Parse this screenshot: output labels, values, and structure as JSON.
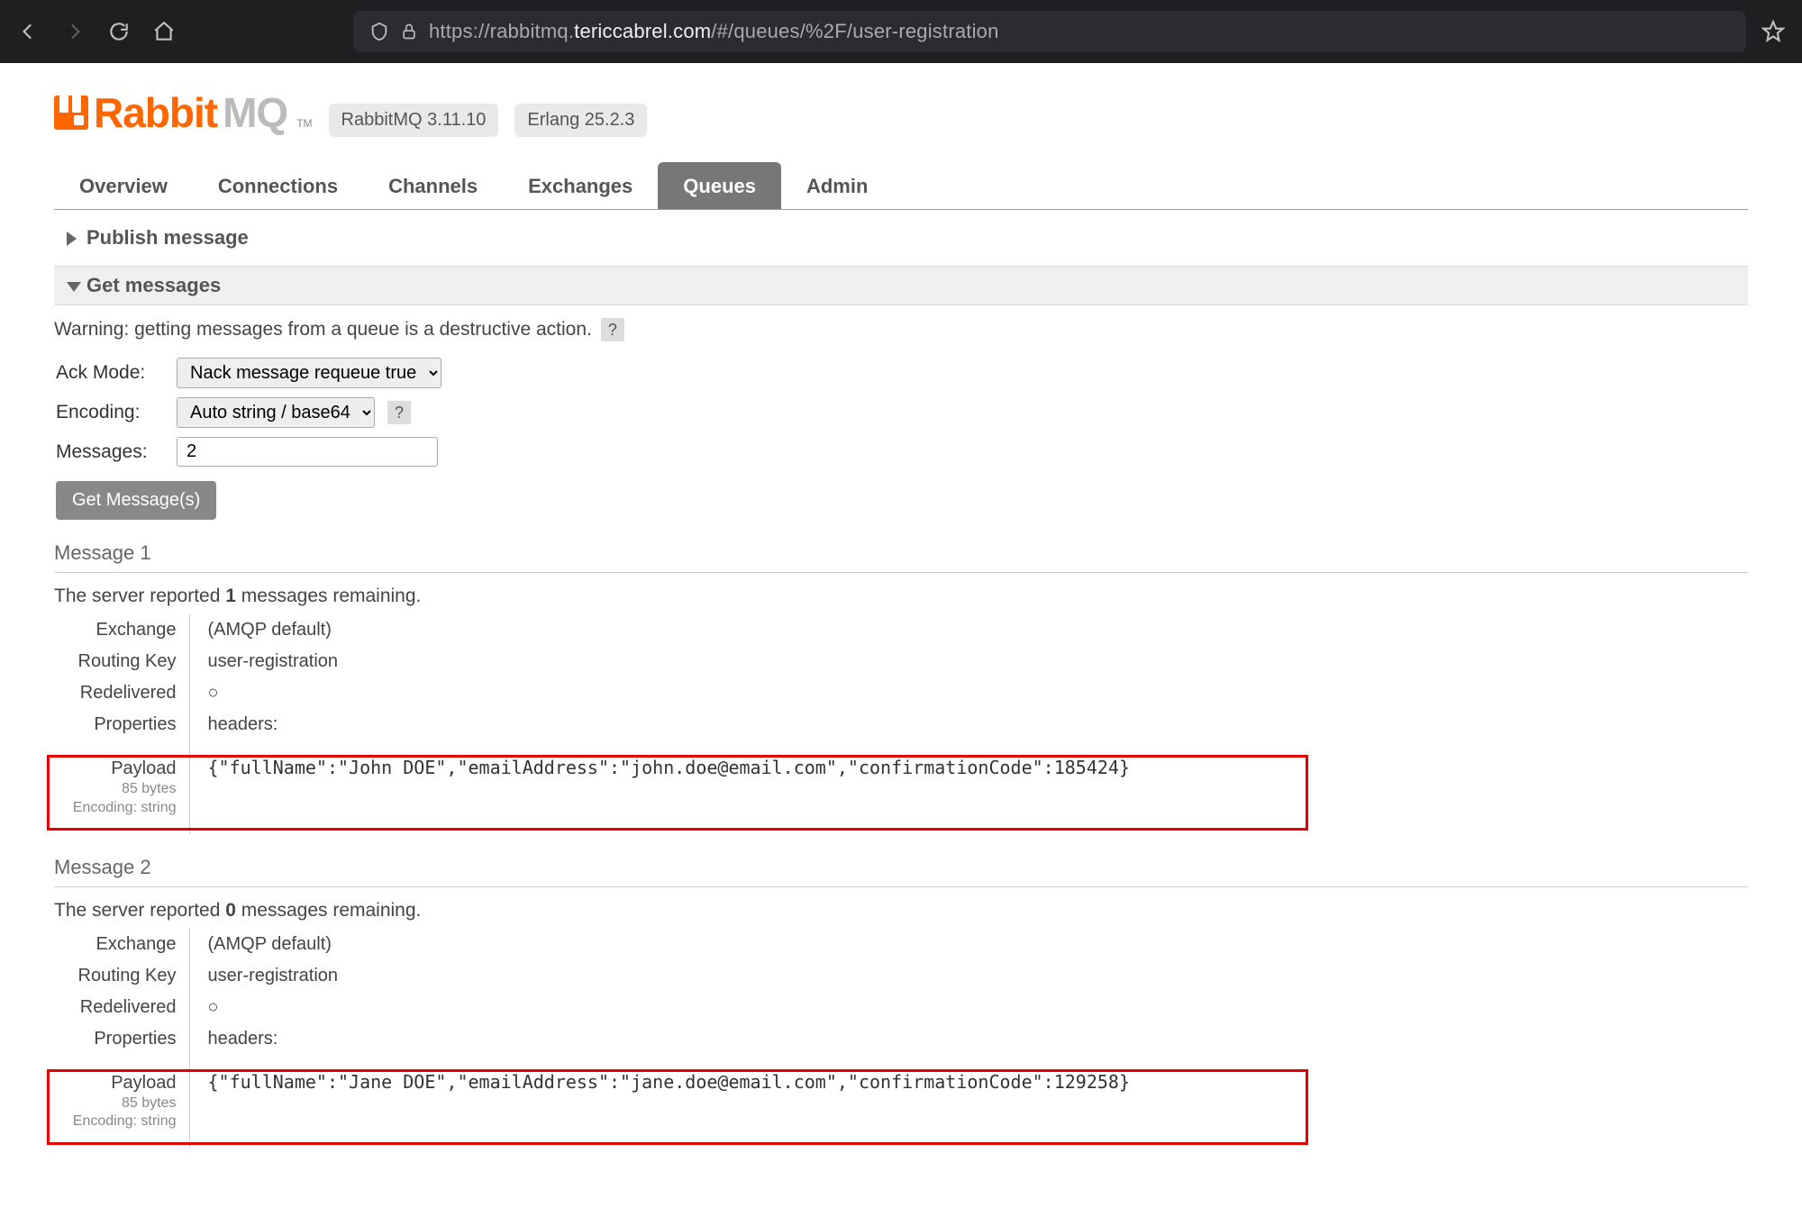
{
  "browser": {
    "url_prefix": "https://rabbitmq.",
    "url_host": "tericcabrel.com",
    "url_suffix": "/#/queues/%2F/user-registration"
  },
  "header": {
    "logo_a": "Rabbit",
    "logo_b": "MQ",
    "tm": "TM",
    "badge_version": "RabbitMQ 3.11.10",
    "badge_erlang": "Erlang 25.2.3"
  },
  "nav": {
    "tabs": [
      "Overview",
      "Connections",
      "Channels",
      "Exchanges",
      "Queues",
      "Admin"
    ],
    "active_index": 4
  },
  "sections": {
    "publish_title": "Publish message",
    "get_title": "Get messages"
  },
  "get": {
    "warning": "Warning: getting messages from a queue is a destructive action.",
    "ack_label": "Ack Mode:",
    "ack_value": "Nack message requeue true",
    "enc_label": "Encoding:",
    "enc_value": "Auto string / base64",
    "msgs_label": "Messages:",
    "msgs_value": "2",
    "button": "Get Message(s)"
  },
  "labels": {
    "exchange": "Exchange",
    "routing_key": "Routing Key",
    "redelivered": "Redelivered",
    "properties": "Properties",
    "payload": "Payload",
    "headers": "headers:",
    "redeliv_mark": "○"
  },
  "messages": [
    {
      "title": "Message 1",
      "remaining_a": "The server reported ",
      "remaining_n": "1",
      "remaining_b": " messages remaining.",
      "exchange": "(AMQP default)",
      "routing_key": "user-registration",
      "bytes": "85 bytes",
      "encoding": "Encoding: string",
      "payload": "{\"fullName\":\"John DOE\",\"emailAddress\":\"john.doe@email.com\",\"confirmationCode\":185424}"
    },
    {
      "title": "Message 2",
      "remaining_a": "The server reported ",
      "remaining_n": "0",
      "remaining_b": " messages remaining.",
      "exchange": "(AMQP default)",
      "routing_key": "user-registration",
      "bytes": "85 bytes",
      "encoding": "Encoding: string",
      "payload": "{\"fullName\":\"Jane DOE\",\"emailAddress\":\"jane.doe@email.com\",\"confirmationCode\":129258}"
    }
  ]
}
